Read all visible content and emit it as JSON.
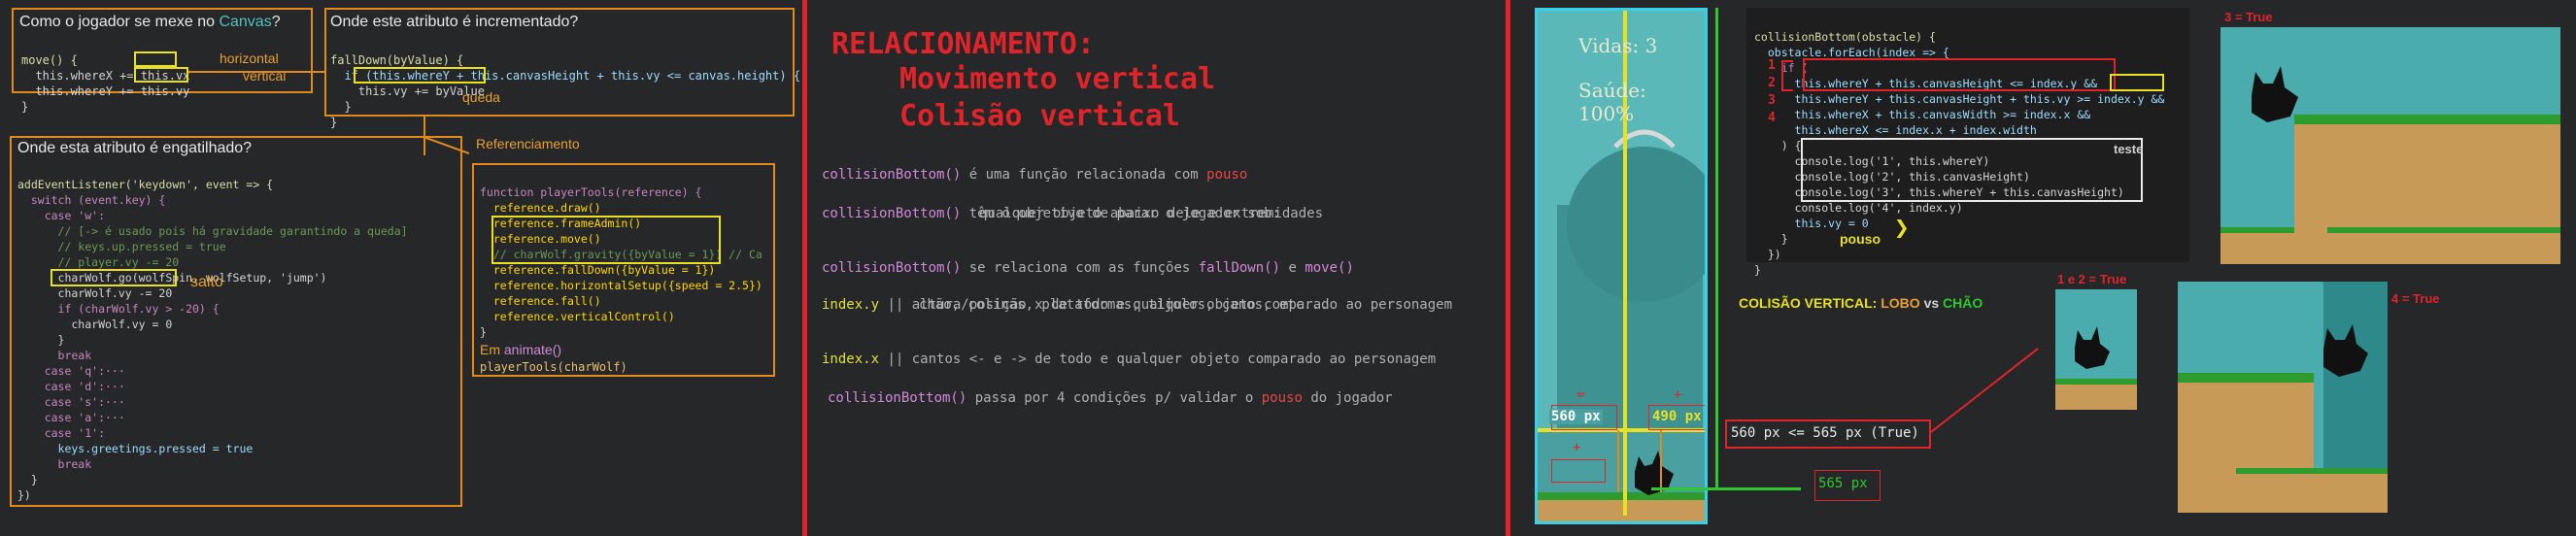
{
  "left": {
    "box1": {
      "title_pre": "Como o jogador se mexe no ",
      "title_kw": "Canvas",
      "title_post": "?",
      "code": [
        "move() {",
        "  this.whereX += this.vx",
        "  this.whereY += this.vy",
        "}"
      ],
      "note_h": "horizontal",
      "note_v": "vertical"
    },
    "box2": {
      "title": "Onde este atributo é incrementado?",
      "code": [
        "fallDown(byValue) {",
        "  if (this.whereY + this.canvasHeight + this.vy <= canvas.height) {",
        "    this.vy += byValue",
        "  }",
        "}"
      ],
      "note": "queda"
    },
    "ref_label": "Referenciamento",
    "box3": {
      "title": "Onde esta atributo é engatilhado?",
      "code": [
        "addEventListener('keydown', event => {",
        "  switch (event.key) {",
        "    case 'w':",
        "      // [-> é usado pois há gravidade garantindo a queda]",
        "      // keys.up.pressed = true",
        "      // player.vy -= 20",
        "      charWolf.go(wolfSpin, wolfSetup, 'jump')",
        "      charWolf.vy -= 20",
        "",
        "      if (charWolf.vy > -20) {",
        "        charWolf.vy = 0",
        "      }",
        "      break",
        "    case 'q':···",
        "    case 'd':···",
        "    case 's':···",
        "    case 'a':···",
        "    case '1':",
        "      keys.greetings.pressed = true",
        "      break",
        "  }",
        "})"
      ],
      "note": "salto"
    },
    "box4": {
      "code": [
        "function playerTools(reference) {",
        "  reference.draw()",
        "  reference.frameAdmin()",
        "  reference.move()",
        "  // charWolf.gravity({byValue = 1}) // Ca",
        "  reference.fallDown({byValue = 1})",
        "  reference.horizontalSetup({speed = 2.5})",
        "  reference.fall()",
        "  reference.verticalControl()",
        "}"
      ],
      "footer1_pre": "Em ",
      "footer1_fn": "animate()",
      "footer2": "playerTools(charWolf)"
    }
  },
  "middle": {
    "title1": "RELACIONAMENTO:",
    "title2": "Movimento vertical",
    "title3": "Colisão vertical",
    "lines": [
      {
        "fn": "collisionBottom()",
        "a": " é uma função relacionada com ",
        "red": "pouso"
      },
      {
        "fn": "collisionBottom()",
        "a": " têm o objetivo de parar o jogador sob:",
        "b": "qualquer objeto abaixo dele e extremidades"
      },
      {
        "fn": "collisionBottom()",
        "a": " se relaciona com as funções ",
        "f1": "fallDown()",
        "and": " e ",
        "f2": "move()"
      },
      {
        "y": "index.y",
        "a": " || altura/posição x de todo e qualquer objeto comparado ao personagem",
        "b": "chão, colinas, plataformas, tijolos, canos, etc..."
      },
      {
        "y": "index.x",
        "a": " || cantos <- e -> de todo e qualquer objeto comparado ao personagem"
      },
      {
        "fn": "collisionBottom()",
        "a": " passa por 4 condições p/ validar o ",
        "red": "pouso",
        "c": " do jogador"
      }
    ]
  },
  "game": {
    "lives": "Vidas: 3",
    "health": "Saúde: 100%",
    "left_eq": "=",
    "left_px": "560 px",
    "right_eq": "+",
    "right_px": "490 px",
    "plus_small": "+",
    "bottom_px": "565 px"
  },
  "right": {
    "code": [
      "collisionBottom(obstacle) {",
      "  obstacle.forEach(index => {",
      "    if (",
      "      this.whereY + this.canvasHeight <= index.y &&",
      "      this.whereY + this.canvasHeight + this.vy >= index.y &&",
      "      this.whereX + this.canvasWidth >= index.x &&",
      "      this.whereX <= index.x + index.width",
      "    ) {",
      "      console.log('1', this.whereY)",
      "      console.log('2', this.canvasHeight)",
      "      console.log('3', this.whereY + this.canvasHeight)",
      "      console.log('4', index.y)",
      "      this.vy = 0",
      "    }",
      "  })",
      "}"
    ],
    "nums": [
      "1",
      "2",
      "3",
      "4"
    ],
    "teste": "teste",
    "pouso": "pouso",
    "three_true": "3 = True",
    "one_two_true": "1 e 2 = True",
    "four_true": "4 = True",
    "colisao_label": "COLISÃO VERTICAL",
    "lobo": "LOBO",
    "vs": " vs ",
    "chao": "CHÃO",
    "compare": "560 px <= 565 px (True)",
    "px565": "565 px"
  }
}
